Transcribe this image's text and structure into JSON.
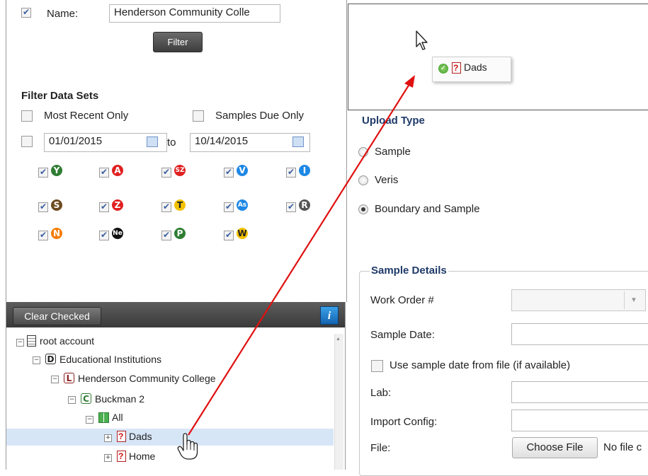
{
  "filter": {
    "name_label": "Name:",
    "name_value": "Henderson Community Colle",
    "filter_button": "Filter",
    "section_title": "Filter Data Sets",
    "most_recent_label": "Most Recent Only",
    "samples_due_label": "Samples Due Only",
    "date_from": "01/01/2015",
    "date_to_word": "to",
    "date_to": "10/14/2015",
    "badges": [
      {
        "letter": "Y",
        "color": "#2e7d32"
      },
      {
        "letter": "A",
        "color": "#e02020"
      },
      {
        "letter": "SZ",
        "color": "#e02020"
      },
      {
        "letter": "V",
        "color": "#1e88e5"
      },
      {
        "letter": "I",
        "color": "#1e88e5"
      },
      {
        "letter": "S",
        "color": "#6d4c21"
      },
      {
        "letter": "Z",
        "color": "#e02020"
      },
      {
        "letter": "T",
        "color": "#f2c200"
      },
      {
        "letter": "As",
        "color": "#1e88e5"
      },
      {
        "letter": "R",
        "color": "#555555"
      },
      {
        "letter": "N",
        "color": "#f57c00"
      },
      {
        "letter": "Ne",
        "color": "#111111"
      },
      {
        "letter": "P",
        "color": "#2e7d32"
      },
      {
        "letter": "W",
        "color": "#f2c200"
      }
    ]
  },
  "tree": {
    "clear_checked": "Clear Checked",
    "info_icon": "i",
    "items": [
      {
        "label": "root account",
        "icon": "document-icon"
      },
      {
        "label": "Educational Institutions",
        "icon": "D"
      },
      {
        "label": "Henderson Community College",
        "icon": "L"
      },
      {
        "label": "Buckman 2",
        "icon": "C"
      },
      {
        "label": "All",
        "icon": "grid-icon"
      },
      {
        "label": "Dads",
        "icon": "report-icon"
      },
      {
        "label": "Home",
        "icon": "report-icon"
      }
    ]
  },
  "drag": {
    "label": "Dads"
  },
  "upload": {
    "type_title": "Upload Type",
    "options": [
      "Sample",
      "Veris",
      "Boundary and Sample"
    ],
    "selected": "Boundary and Sample"
  },
  "sample_details": {
    "legend": "Sample Details",
    "work_order_label": "Work Order #",
    "sample_date_label": "Sample Date:",
    "use_sample_date_label": "Use sample date from file (if available)",
    "lab_label": "Lab:",
    "import_config_label": "Import Config:",
    "file_label": "File:",
    "choose_file": "Choose File",
    "no_file": "No file c"
  },
  "colors": {
    "annotation_arrow": "#e01010",
    "section_title": "#1f3a68"
  }
}
